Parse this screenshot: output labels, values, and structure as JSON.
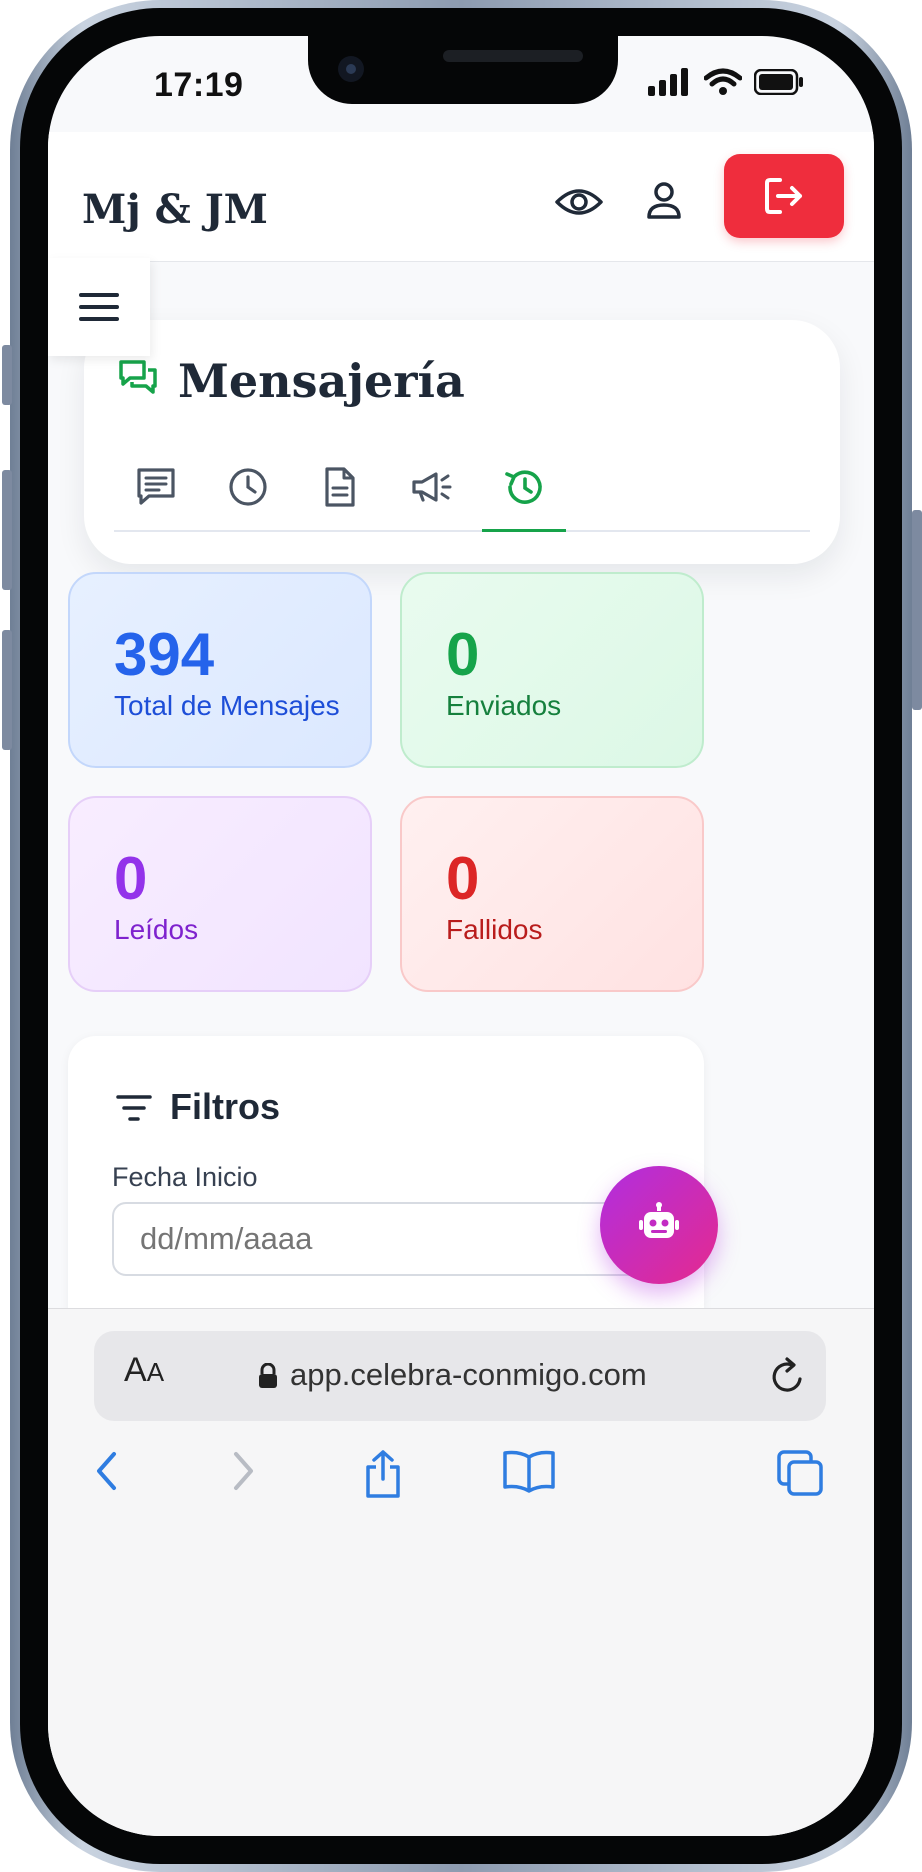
{
  "status_bar": {
    "time": "17:19"
  },
  "header": {
    "brand": "Mj & JM"
  },
  "page": {
    "title": "Mensajería"
  },
  "tabs": [
    {
      "name": "messages"
    },
    {
      "name": "scheduled"
    },
    {
      "name": "templates"
    },
    {
      "name": "campaigns"
    },
    {
      "name": "history",
      "active": true
    }
  ],
  "stats": {
    "total": {
      "value": "394",
      "label": "Total de Mensajes"
    },
    "sent": {
      "value": "0",
      "label": "Enviados"
    },
    "read": {
      "value": "0",
      "label": "Leídos"
    },
    "failed": {
      "value": "0",
      "label": "Fallidos"
    }
  },
  "filters": {
    "title": "Filtros",
    "start_date_label": "Fecha Inicio",
    "start_date_placeholder": "dd/mm/aaaa"
  },
  "browser": {
    "aa_big": "A",
    "aa_small": "A",
    "url": "app.celebra-conmigo.com"
  },
  "colors": {
    "accent_green": "#16a34a",
    "logout_red": "#ef2d3d",
    "stat_blue": "#2563eb",
    "stat_green": "#16a34a",
    "stat_purple": "#9333ea",
    "stat_red": "#dc2626",
    "safari_blue": "#2f7de1"
  }
}
